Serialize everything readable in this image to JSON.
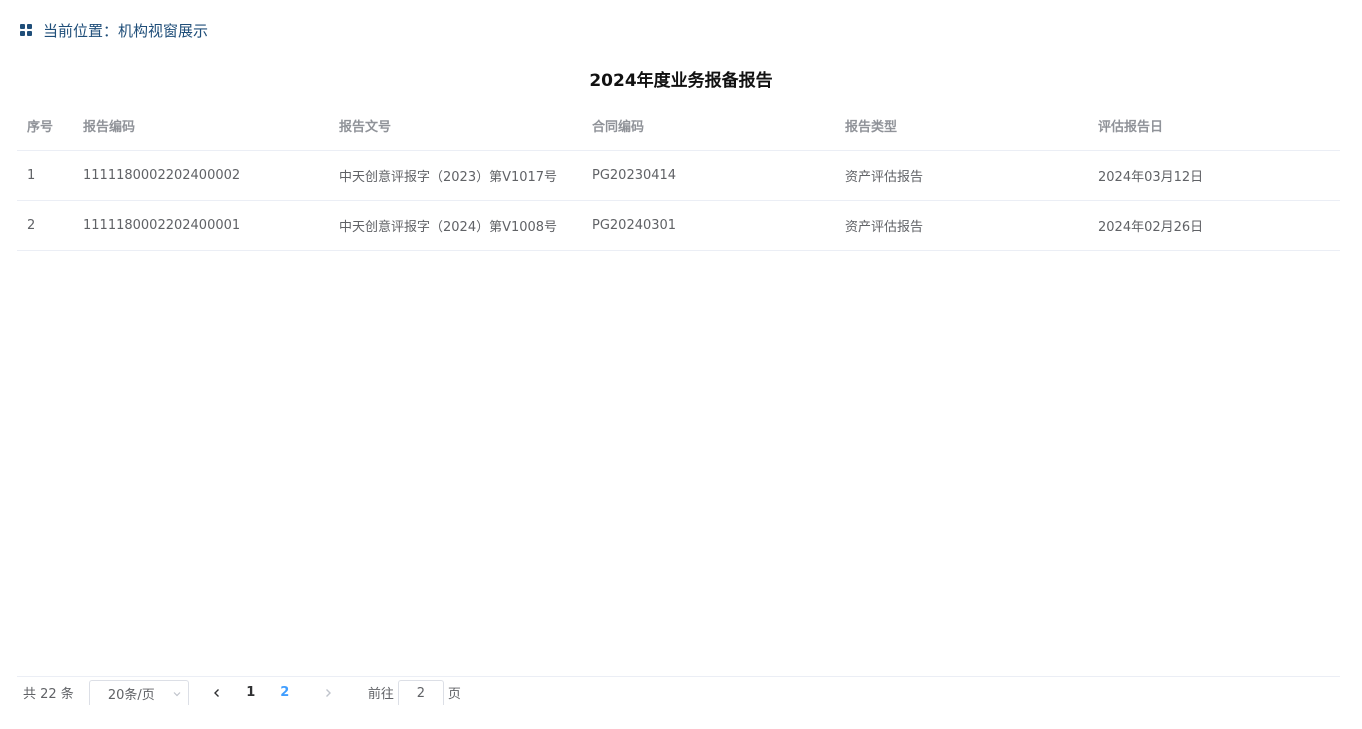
{
  "breadcrumb": {
    "label": "当前位置：",
    "current": "机构视窗展示"
  },
  "report": {
    "title": "2024年度业务报备报告"
  },
  "table": {
    "headers": [
      "序号",
      "报告编码",
      "报告文号",
      "合同编码",
      "报告类型",
      "评估报告日"
    ],
    "rows": [
      [
        "1",
        "1111180002202400002",
        "中天创意评报字（2023）第V1017号",
        "PG20230414",
        "资产评估报告",
        "2024年03月12日"
      ],
      [
        "2",
        "1111180002202400001",
        "中天创意评报字（2024）第V1008号",
        "PG20240301",
        "资产评估报告",
        "2024年02月26日"
      ]
    ]
  },
  "pagination": {
    "total_label": "共 22 条",
    "page_size": "20条/页",
    "pages": [
      "1",
      "2"
    ],
    "current_page": "2",
    "goto_label": "前往",
    "goto_value": "2",
    "goto_suffix": "页"
  },
  "colors": {
    "accent": "#409eff",
    "breadcrumb": "#1f4e79"
  }
}
